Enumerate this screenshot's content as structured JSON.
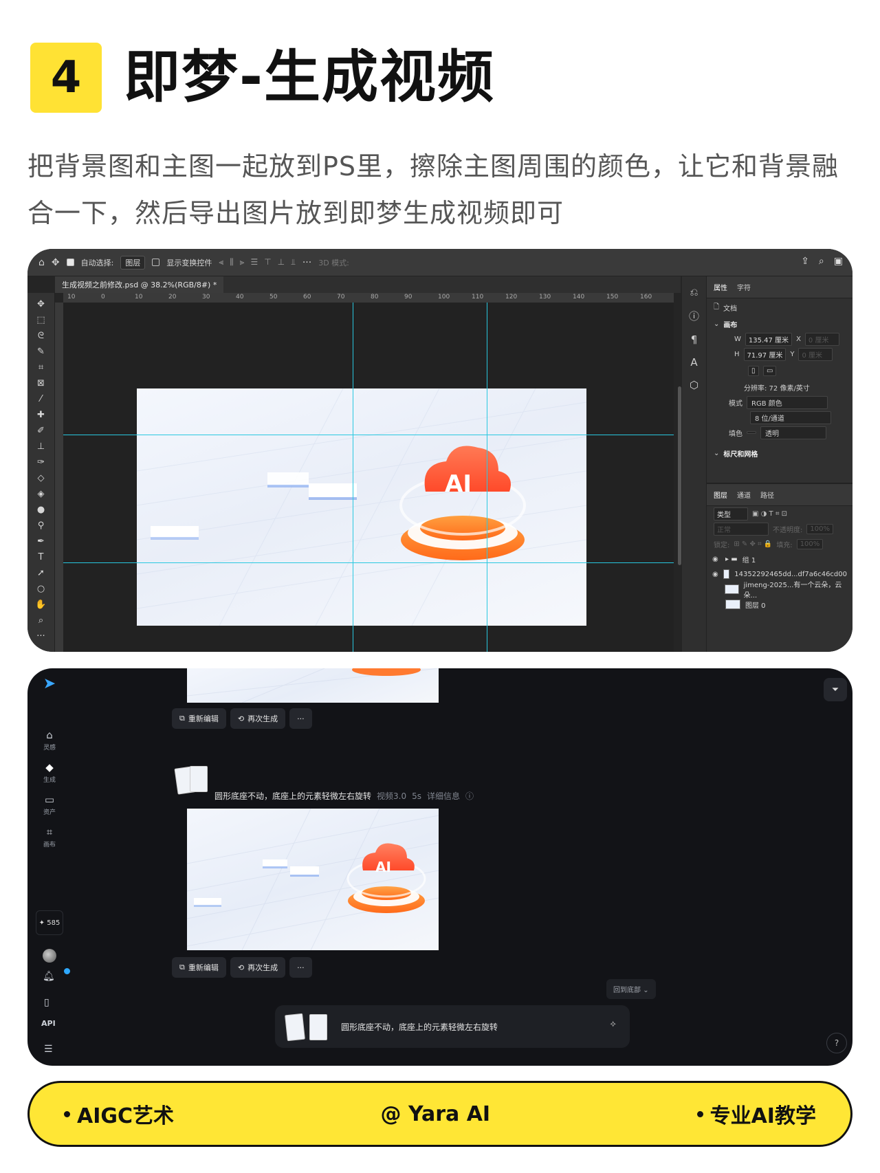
{
  "header": {
    "step_number": "4",
    "title": "即梦-生成视频",
    "description": "把背景图和主图一起放到PS里，擦除主图周围的颜色，让它和背景融合一下，然后导出图片放到即梦生成视频即可"
  },
  "photoshop": {
    "options": {
      "auto_select_label": "自动选择:",
      "auto_select_value": "图层",
      "show_transform_label": "显示变换控件",
      "mode_3d_label": "3D 模式:"
    },
    "document_tab": "生成视频之前修改.psd @ 38.2%(RGB/8#) *",
    "ruler_ticks": [
      "10",
      "0",
      "10",
      "20",
      "30",
      "40",
      "50",
      "60",
      "70",
      "80",
      "90",
      "100",
      "110",
      "120",
      "130",
      "140",
      "150",
      "160"
    ],
    "properties": {
      "tab_properties": "属性",
      "tab_character": "字符",
      "doc_label": "文档",
      "canvas_section": "画布",
      "w_label": "W",
      "w_value": "135.47 厘米",
      "h_label": "H",
      "h_value": "71.97 厘米",
      "x_label": "X",
      "x_value": "0 厘米",
      "y_label": "Y",
      "y_value": "0 厘米",
      "resolution": "分辨率: 72 像素/英寸",
      "mode_label": "模式",
      "mode_value": "RGB 颜色",
      "bit_value": "8 位/通道",
      "fill_label": "填色",
      "fill_value": "透明",
      "rulers_section": "标尺和网格"
    },
    "layers": {
      "tab_layers": "图层",
      "tab_channels": "通道",
      "tab_paths": "路径",
      "filter_kind": "类型",
      "blend_mode": "正常",
      "opacity_label": "不透明度:",
      "opacity_value": "100%",
      "lock_label": "锁定:",
      "fill_label": "填充:",
      "fill_value": "100%",
      "items": [
        {
          "name": "组 1",
          "visible": true
        },
        {
          "name": "14352292465dd...df7a6c46cd00",
          "visible": true
        },
        {
          "name": "jimeng-2025...有一个云朵，云朵...",
          "visible": false
        },
        {
          "name": "图层 0",
          "visible": false
        }
      ]
    },
    "image_text": "AI"
  },
  "jimeng": {
    "nav": [
      {
        "icon": "home-icon",
        "label": "灵感"
      },
      {
        "icon": "sparkle-icon",
        "label": "生成"
      },
      {
        "icon": "folder-icon",
        "label": "资产"
      },
      {
        "icon": "canvas-icon",
        "label": "画布"
      }
    ],
    "credits": "✦ 585",
    "notification_count": "1",
    "api_label": "API",
    "buttons": {
      "reedit": "重新编辑",
      "regenerate": "再次生成",
      "more": "···"
    },
    "prompt": "圆形底座不动，底座上的元素轻微左右旋转",
    "model": "视频3.0",
    "duration": "5s",
    "details": "详细信息",
    "back_to_bottom": "回到底部",
    "input_prompt": "圆形底座不动，底座上的元素轻微左右旋转",
    "image_text": "AI"
  },
  "footer": {
    "left": "AIGC艺术",
    "center": "@ Yara AI",
    "right": "专业AI教学"
  },
  "colors": {
    "accent_yellow": "#ffe234",
    "ps_dark": "#252525",
    "jimeng_dark": "#121317",
    "guide_cyan": "#28c8e0",
    "cloud_orange": "#ff6a3d"
  }
}
